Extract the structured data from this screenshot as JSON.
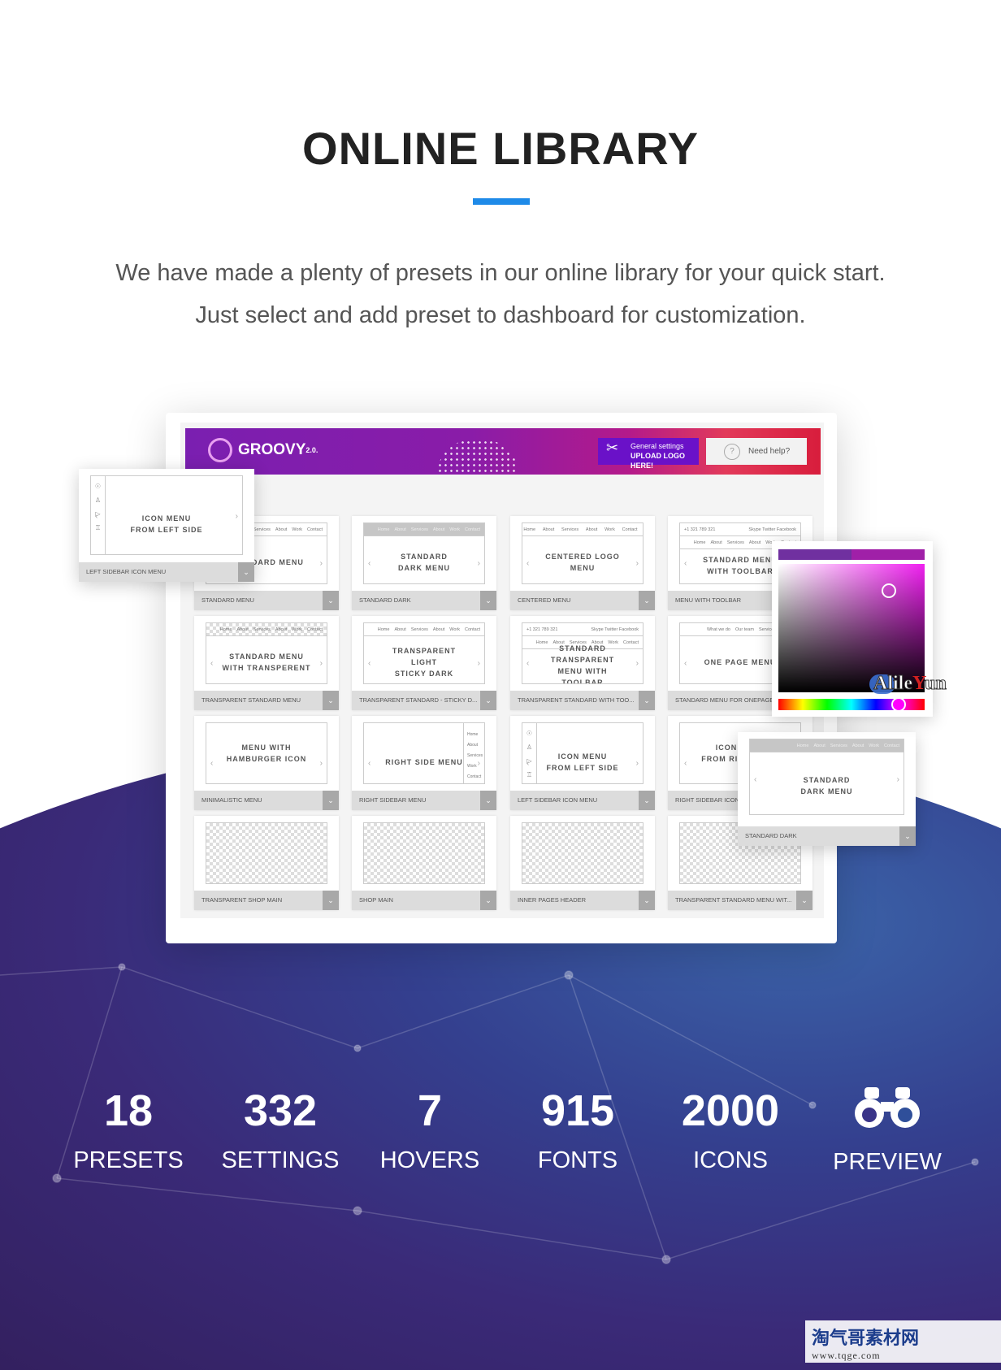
{
  "header": {
    "title": "ONLINE LIBRARY",
    "accent": "#1e8ae8",
    "lines": [
      "We have made a plenty of presets in our online library for your quick start.",
      "Just select and add preset to dashboard for customization."
    ]
  },
  "dashboard": {
    "brand": "GROOVY",
    "version": "2.0.",
    "settings": {
      "line1": "General settings",
      "line2": "UPLOAD LOGO HERE!",
      "icon": "tools-icon"
    },
    "help": {
      "label": "Need help?",
      "icon": "question-icon"
    },
    "nav_items": [
      "Home",
      "About",
      "Services",
      "About",
      "Work",
      "Contact"
    ],
    "tiles": [
      {
        "label": "STANDARD MENU",
        "title": "STANDARD MENU",
        "nav": "plain"
      },
      {
        "label": "STANDARD DARK",
        "title": "STANDARD\nDARK MENU",
        "nav": "dark"
      },
      {
        "label": "CENTERED MENU",
        "title": "CENTERED LOGO MENU",
        "nav": "center"
      },
      {
        "label": "MENU WITH TOOLBAR",
        "title": "STANDARD MENU\nWITH TOOLBAR",
        "nav": "toolbar"
      },
      {
        "label": "TRANSPARENT STANDARD MENU",
        "title": "STANDARD MENU\nWITH TRANSPERENT",
        "nav": "check"
      },
      {
        "label": "TRANSPARENT STANDARD - STICKY D...",
        "title": "TRANSPARENT LIGHT\nSTICKY DARK",
        "nav": "plain"
      },
      {
        "label": "TRANSPARENT STANDARD WITH TOO...",
        "title": "STANDARD TRANSPARENT\nMENU WITH TOOLBAR",
        "nav": "toolbar"
      },
      {
        "label": "STANDARD MENU FOR ONEPAGE",
        "title": "ONE PAGE MENU",
        "nav": "onepage",
        "nav_items": [
          "What we do",
          "Our team",
          "Services",
          "Contact"
        ]
      },
      {
        "label": "MINIMALISTIC MENU",
        "title": "MENU WITH\nHAMBURGER ICON",
        "nav": "none"
      },
      {
        "label": "RIGHT SIDEBAR MENU",
        "title": "RIGHT SIDE MENU",
        "nav": "rightside",
        "side_items": [
          "Home",
          "About",
          "Services",
          "Work",
          "Contact"
        ]
      },
      {
        "label": "LEFT SIDEBAR ICON MENU",
        "title": "ICON MENU\nFROM LEFT SIDE",
        "nav": "leftside"
      },
      {
        "label": "RIGHT SIDEBAR ICON MENU",
        "title": "ICON MENU\nFROM RIGHT SIDE",
        "nav": "none"
      },
      {
        "label": "TRANSPARENT SHOP MAIN",
        "nav": "checker"
      },
      {
        "label": "SHOP MAIN",
        "nav": "checker"
      },
      {
        "label": "INNER PAGES HEADER",
        "nav": "checker"
      },
      {
        "label": "TRANSPARENT STANDARD MENU WIT...",
        "nav": "checker"
      }
    ],
    "toolbar_left": "+1 321 789 321",
    "toolbar_right": "Skype Twitter Facebook"
  },
  "floating_left": {
    "title": "ICON MENU\nFROM LEFT SIDE",
    "label": "LEFT SIDEBAR ICON MENU"
  },
  "floating_right": {
    "title": "STANDARD\nDARK MENU",
    "label": "STANDARD DARK"
  },
  "color_picker": {
    "selected_color": "#f020f0",
    "swatch_old": "#7030a0",
    "swatch_new": "#a020a8",
    "hue_percent": 85
  },
  "stats": [
    {
      "value": "18",
      "label": "PRESETS"
    },
    {
      "value": "332",
      "label": "SETTINGS"
    },
    {
      "value": "7",
      "label": "HOVERS"
    },
    {
      "value": "915",
      "label": "FONTS"
    },
    {
      "value": "2000",
      "label": "ICONS"
    },
    {
      "icon": "binoculars-icon",
      "label": "PREVIEW"
    }
  ],
  "watermarks": {
    "alileyun": "AlileYun",
    "site_cn": "淘气哥素材网",
    "site_url": "www.tqge.com"
  }
}
